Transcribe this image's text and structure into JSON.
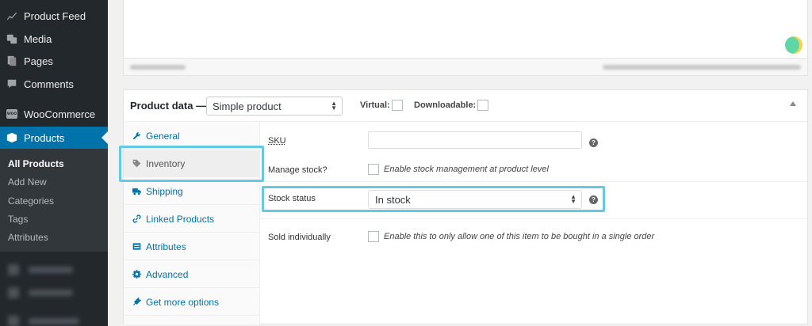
{
  "sidebar": {
    "items": [
      {
        "label": "Product Feed",
        "icon": "chart-icon"
      },
      {
        "label": "Media",
        "icon": "media-icon"
      },
      {
        "label": "Pages",
        "icon": "pages-icon"
      },
      {
        "label": "Comments",
        "icon": "comments-icon"
      },
      {
        "label": "WooCommerce",
        "icon": "woocommerce-icon",
        "badge": "woo"
      },
      {
        "label": "Products",
        "icon": "products-icon"
      }
    ],
    "submenu": [
      {
        "label": "All Products"
      },
      {
        "label": "Add New"
      },
      {
        "label": "Categories"
      },
      {
        "label": "Tags"
      },
      {
        "label": "Attributes"
      }
    ]
  },
  "product_data": {
    "title": "Product data —",
    "product_type": "Simple product",
    "virtual_label": "Virtual:",
    "downloadable_label": "Downloadable:",
    "tabs": [
      {
        "label": "General",
        "icon": "wrench-icon"
      },
      {
        "label": "Inventory",
        "icon": "tag-icon"
      },
      {
        "label": "Shipping",
        "icon": "truck-icon"
      },
      {
        "label": "Linked Products",
        "icon": "link-icon"
      },
      {
        "label": "Attributes",
        "icon": "table-icon"
      },
      {
        "label": "Advanced",
        "icon": "gear-icon"
      },
      {
        "label": "Get more options",
        "icon": "plugin-icon"
      }
    ],
    "fields": {
      "sku_label": "SKU",
      "sku_value": "",
      "manage_stock_label": "Manage stock?",
      "manage_stock_desc": "Enable stock management at product level",
      "stock_status_label": "Stock status",
      "stock_status_value": "In stock",
      "sold_individually_label": "Sold individually",
      "sold_individually_desc": "Enable this to only allow one of this item to be bought in a single order"
    },
    "help_glyph": "?"
  },
  "colors": {
    "admin_bar": "#23282d",
    "accent": "#0073aa",
    "highlight": "#65c8e4"
  }
}
